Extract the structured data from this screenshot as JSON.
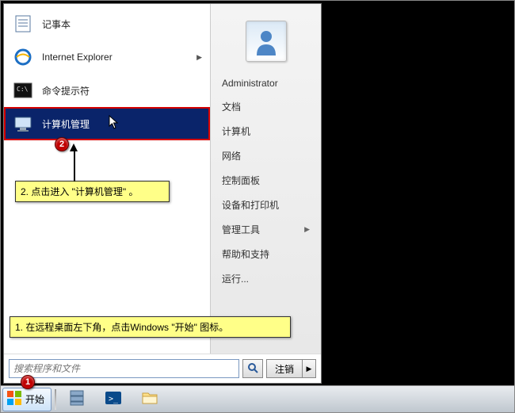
{
  "start_menu": {
    "left_items": [
      {
        "label": "记事本",
        "icon": "notepad-icon",
        "has_sub": false
      },
      {
        "label": "Internet Explorer",
        "icon": "ie-icon",
        "has_sub": true
      },
      {
        "label": "命令提示符",
        "icon": "cmd-icon",
        "has_sub": false
      },
      {
        "label": "计算机管理",
        "icon": "compmgmt-icon",
        "has_sub": false,
        "selected": true
      }
    ],
    "right_items": [
      {
        "label": "Administrator",
        "has_sub": false
      },
      {
        "label": "文档",
        "has_sub": false
      },
      {
        "label": "计算机",
        "has_sub": false
      },
      {
        "label": "网络",
        "has_sub": false
      },
      {
        "label": "控制面板",
        "has_sub": false
      },
      {
        "label": "设备和打印机",
        "has_sub": false
      },
      {
        "label": "管理工具",
        "has_sub": true
      },
      {
        "label": "帮助和支持",
        "has_sub": false
      },
      {
        "label": "运行...",
        "has_sub": false
      }
    ],
    "search_placeholder": "搜索程序和文件",
    "logoff_label": "注销"
  },
  "taskbar": {
    "start_label": "开始"
  },
  "annotations": {
    "step1": "1. 在远程桌面左下角，点击Windows \"开始\" 图标。",
    "step2": "2. 点击进入 \"计算机管理\" 。",
    "badge1": "1",
    "badge2": "2"
  },
  "icons": {
    "notepad": "📝",
    "ie": "🌐",
    "cmd": "▮",
    "compmgmt": "🖥",
    "search": "🔍",
    "win": "⊞",
    "server": "🗄",
    "powershell": "▶",
    "explorer": "📁",
    "user": "👤"
  }
}
